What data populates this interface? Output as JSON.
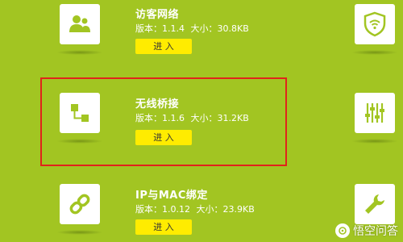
{
  "apps": [
    {
      "name": "访客网络",
      "version_label": "版本：1.1.4",
      "size_label": "大小：30.8KB",
      "button_label": "进 入",
      "icon": "users-icon"
    },
    {
      "name": "无线桥接",
      "version_label": "版本：1.1.6",
      "size_label": "大小：31.2KB",
      "button_label": "进 入",
      "icon": "bridge-icon"
    },
    {
      "name": "IP与MAC绑定",
      "version_label": "版本：1.0.12",
      "size_label": "大小：23.9KB",
      "button_label": "进 入",
      "icon": "link-icon"
    }
  ],
  "right_icons": [
    "wifi-shield-icon",
    "sliders-icon",
    "wrench-icon"
  ],
  "watermark": {
    "text": "悟空问答"
  },
  "colors": {
    "background": "#a2c522",
    "button": "#ffec00",
    "highlight": "#e0241b",
    "icon_fill": "#a2c522"
  }
}
